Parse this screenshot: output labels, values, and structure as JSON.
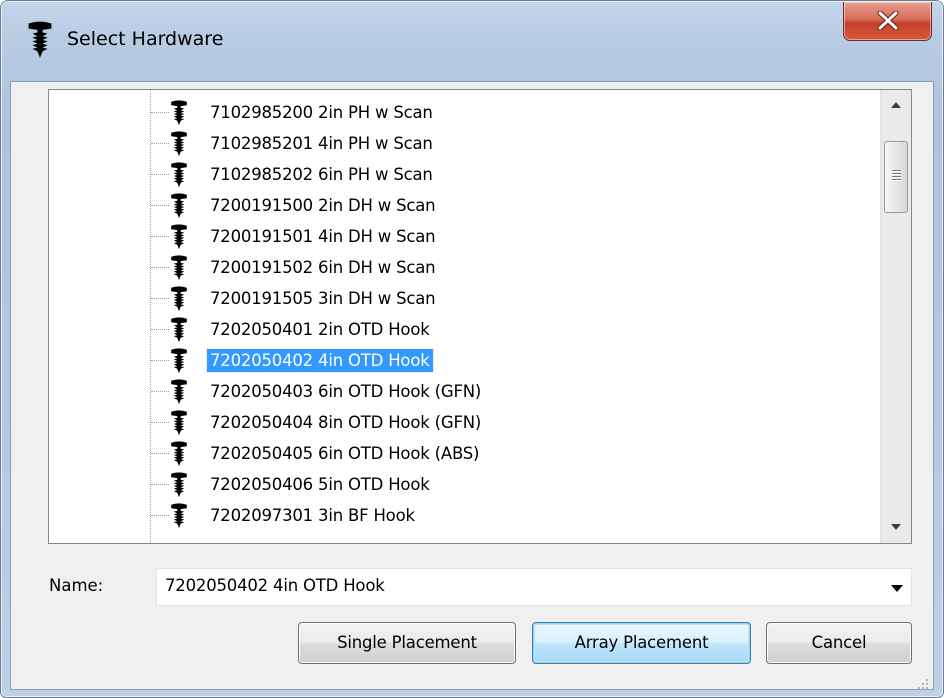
{
  "window": {
    "title": "Select Hardware",
    "icon": "screw-icon",
    "close_icon": "close-icon"
  },
  "tree": {
    "selected_index": 8,
    "items": [
      {
        "label": "7102985200 2in PH w Scan"
      },
      {
        "label": "7102985201 4in PH w Scan"
      },
      {
        "label": "7102985202 6in PH w Scan"
      },
      {
        "label": "7200191500 2in DH w Scan"
      },
      {
        "label": "7200191501 4in DH w Scan"
      },
      {
        "label": "7200191502 6in DH w Scan"
      },
      {
        "label": "7200191505 3in DH w Scan"
      },
      {
        "label": "7202050401 2in OTD Hook"
      },
      {
        "label": "7202050402 4in OTD Hook"
      },
      {
        "label": "7202050403 6in OTD Hook (GFN)"
      },
      {
        "label": "7202050404 8in OTD Hook (GFN)"
      },
      {
        "label": "7202050405 6in OTD Hook (ABS)"
      },
      {
        "label": "7202050406 5in OTD Hook"
      },
      {
        "label": "7202097301 3in BF Hook"
      }
    ]
  },
  "name_field": {
    "label": "Name:",
    "value": "7202050402 4in OTD Hook"
  },
  "buttons": {
    "single_placement": "Single Placement",
    "array_placement": "Array Placement",
    "cancel": "Cancel"
  },
  "colors": {
    "selection": "#3399ff",
    "close_button": "#c74b33",
    "default_button_border": "#3c7fb1"
  }
}
